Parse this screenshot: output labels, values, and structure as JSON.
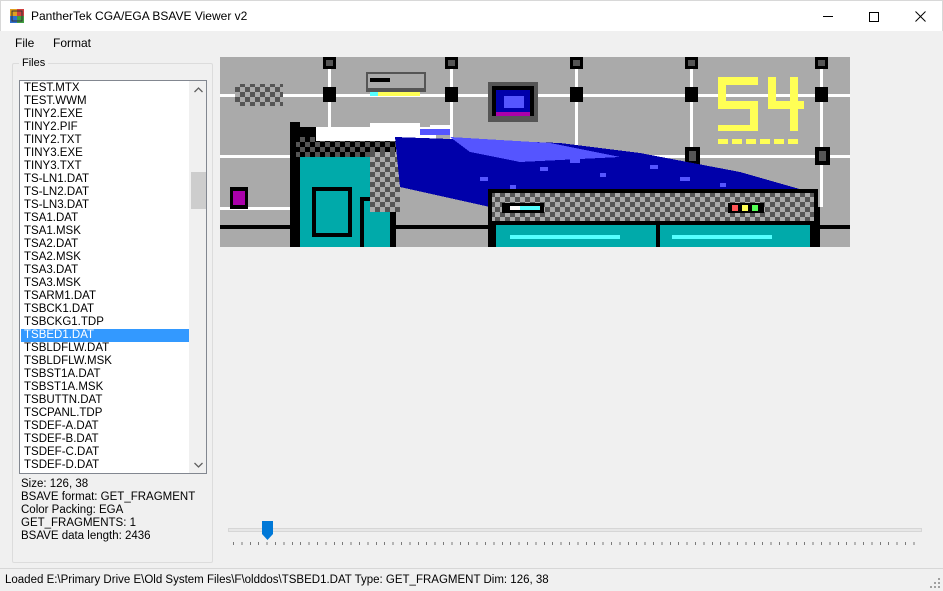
{
  "window": {
    "title": "PantherTek CGA/EGA BSAVE Viewer v2"
  },
  "menu": {
    "file": "File",
    "format": "Format"
  },
  "files_group": {
    "label": "Files",
    "items": [
      "TEST.MTX",
      "TEST.WWM",
      "TINY2.EXE",
      "TINY2.PIF",
      "TINY2.TXT",
      "TINY3.EXE",
      "TINY3.TXT",
      "TS-LN1.DAT",
      "TS-LN2.DAT",
      "TS-LN3.DAT",
      "TSA1.DAT",
      "TSA1.MSK",
      "TSA2.DAT",
      "TSA2.MSK",
      "TSA3.DAT",
      "TSA3.MSK",
      "TSARM1.DAT",
      "TSBCK1.DAT",
      "TSBCKG1.TDP",
      "TSBED1.DAT",
      "TSBLDFLW.DAT",
      "TSBLDFLW.MSK",
      "TSBST1A.DAT",
      "TSBST1A.MSK",
      "TSBUTTN.DAT",
      "TSCPANL.TDP",
      "TSDEF-A.DAT",
      "TSDEF-B.DAT",
      "TSDEF-C.DAT",
      "TSDEF-D.DAT"
    ],
    "selected": "TSBED1.DAT"
  },
  "info": {
    "size": "Size: 126, 38",
    "format": "BSAVE format: GET_FRAGMENT",
    "packing": "Color Packing: EGA",
    "fragments": "GET_FRAGMENTS: 1",
    "length": "BSAVE data length: 2436"
  },
  "slider": {
    "value_fraction": 0.05
  },
  "status": {
    "text": "Loaded E:\\Primary Drive E\\Old System Files\\F\\olddos\\TSBED1.DAT Type: GET_FRAGMENT Dim: 126, 38"
  },
  "colors": {
    "ega_black": "#000000",
    "ega_blue": "#0000aa",
    "ega_cyan": "#00aaaa",
    "ega_magenta": "#aa00aa",
    "ega_lightgray": "#aaaaaa",
    "ega_darkgray": "#555555",
    "ega_lightblue": "#5555ff",
    "ega_lightcyan": "#55ffff",
    "ega_yellow": "#ffff55",
    "ega_white": "#ffffff",
    "selection": "#3399ff"
  }
}
